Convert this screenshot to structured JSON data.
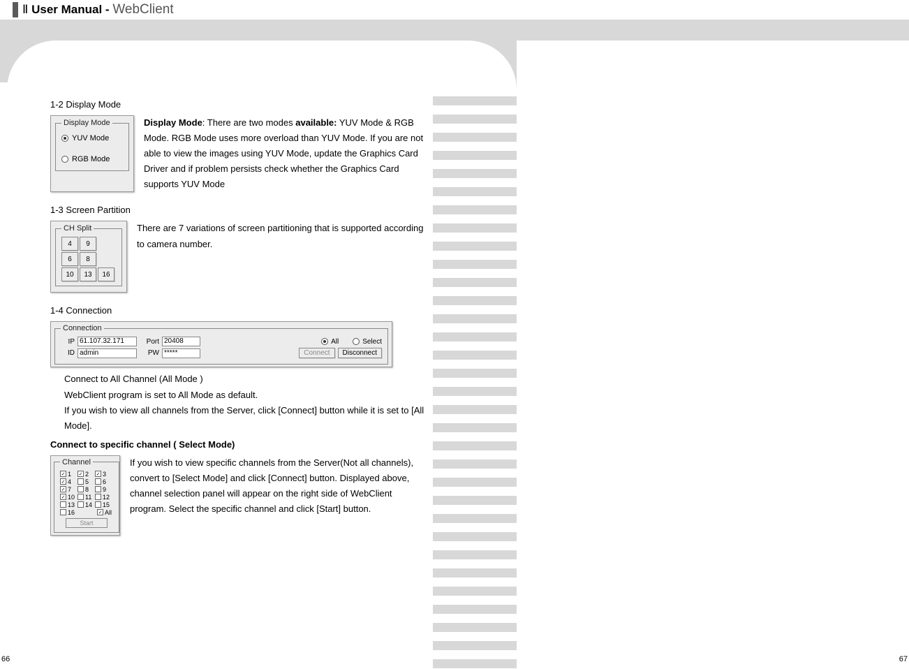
{
  "header": {
    "part1": "Ⅱ",
    "part2": "User Manual -",
    "part3": "WebClient"
  },
  "sections": {
    "s12": {
      "heading": "1-2 Display Mode",
      "fieldset_title": "Display Mode",
      "opt1": "YUV Mode",
      "opt2": "RGB Mode",
      "text_bold1": "Display Mode",
      "text_1": ": There are two modes ",
      "text_bold2": "available:",
      "text_2": " YUV Mode & RGB Mode. RGB Mode uses more overload than YUV Mode. If you are not able to view the images using YUV Mode, update the Graphics Card Driver and if problem persists check whether the Graphics Card supports YUV Mode"
    },
    "s13": {
      "heading": "1-3 Screen Partition",
      "fieldset_title": "CH Split",
      "buttons": [
        "4",
        "9",
        "",
        "6",
        "8",
        "",
        "10",
        "13",
        "16"
      ],
      "text": "There are 7 variations of screen partitioning that is supported according to camera number."
    },
    "s14": {
      "heading": "1-4 Connection",
      "conn": {
        "legend": "Connection",
        "ip_lbl": "IP",
        "ip_val": "61.107.32.171",
        "port_lbl": "Port",
        "port_val": "20408",
        "id_lbl": "ID",
        "id_val": "admin",
        "pw_lbl": "PW",
        "pw_val": "*****",
        "all": "All",
        "select": "Select",
        "connect": "Connect",
        "disconnect": "Disconnect"
      },
      "para1": "Connect to All Channel (All Mode )",
      "para2": "WebClient program is set to All Mode as default.",
      "para3": "If you wish to view all channels from the Server, click [Connect] button while it is set to [All Mode].",
      "heading2": "Connect to specific channel ( Select Mode)",
      "text2": "If you wish to view specific channels from the Server(Not all channels), convert to [Select Mode] and click [Connect] button. Displayed above, channel selection panel will appear on the right side of WebClient program. Select the specific channel and click [Start] button.",
      "channel": {
        "legend": "Channel",
        "rows": [
          [
            {
              "n": "1",
              "c": true
            },
            {
              "n": "2",
              "c": true
            },
            {
              "n": "3",
              "c": true
            }
          ],
          [
            {
              "n": "4",
              "c": true
            },
            {
              "n": "5",
              "c": false
            },
            {
              "n": "6",
              "c": false
            }
          ],
          [
            {
              "n": "7",
              "c": true
            },
            {
              "n": "8",
              "c": false
            },
            {
              "n": "9",
              "c": false
            }
          ],
          [
            {
              "n": "10",
              "c": true
            },
            {
              "n": "11",
              "c": false
            },
            {
              "n": "12",
              "c": false
            }
          ],
          [
            {
              "n": "13",
              "c": false
            },
            {
              "n": "14",
              "c": false
            },
            {
              "n": "15",
              "c": false
            }
          ],
          [
            {
              "n": "16",
              "c": false
            },
            {
              "n": "",
              "c": null
            },
            {
              "n": "All",
              "c": true
            }
          ]
        ],
        "start": "Start"
      }
    }
  },
  "page_left": "66",
  "page_right": "67"
}
